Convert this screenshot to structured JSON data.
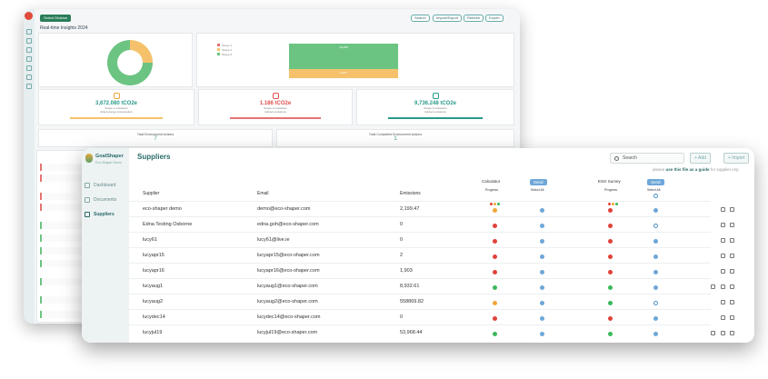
{
  "dashboard": {
    "header_chip": "Select Division",
    "title": "Real-time Insights 2024",
    "top_buttons": [
      "Search",
      "Import/Export",
      "Refresh",
      "Export"
    ],
    "bar_labels": {
      "top": "18,358",
      "bottom": "3,675"
    },
    "legend": [
      "Scope 1",
      "Scope 2",
      "Scope 3"
    ],
    "kpis": [
      {
        "value": "3,672.080 tCO2e",
        "label": "Scope 1 emissions",
        "note": "direct energy consumption",
        "color": "#2a9a8a",
        "bar_color": "#f5c26b"
      },
      {
        "value": "1.186 tCO2e",
        "label": "Scope 2 emissions",
        "note": "indirect emissions",
        "color": "#e05050",
        "bar_color": "#e57373"
      },
      {
        "value": "9,736.248 tCO2e",
        "label": "Scope 3 emissions",
        "note": "indirect emissions",
        "color": "#2a9a8a",
        "bar_color": "#2a9a8a"
      }
    ],
    "totals": [
      {
        "label": "Total Environment Actions",
        "value": "7"
      },
      {
        "label": "Total Completed Environment Actions",
        "value": "1"
      }
    ]
  },
  "sidebar": {
    "brand": "GoalShaper",
    "tagline": "Eco-Shaper Demo",
    "items": [
      {
        "label": "Dashboard",
        "icon": "dashboard-icon"
      },
      {
        "label": "Documents",
        "icon": "documents-icon"
      },
      {
        "label": "Suppliers",
        "icon": "suppliers-icon",
        "active": true
      }
    ]
  },
  "page": {
    "title": "Suppliers",
    "search_placeholder": "Search",
    "add_label": "+ Add",
    "import_label": "+ Import",
    "guide_prefix": "please",
    "guide_link": "use this file as a guide",
    "guide_suffix": "for supplier imp"
  },
  "table": {
    "headers": {
      "supplier": "Supplier",
      "email": "Email",
      "emissions": "Emissions"
    },
    "calculator": {
      "title": "Calculator",
      "send": "Send",
      "progress": "Progress",
      "select_all": "Select All"
    },
    "survey": {
      "title": "ESG Survey",
      "send": "Send",
      "progress": "Progress",
      "select_all": "Select All"
    },
    "rows": [
      {
        "supplier": "eco-shaper demo",
        "email": "demo@eco-shaper.com",
        "emissions": "2,199.47",
        "calc": "orange",
        "survey": "red",
        "survey_sel": "dot"
      },
      {
        "supplier": "Edna Testing Osborne",
        "email": "edna.goh@eco-shaper.com",
        "emissions": "0",
        "calc": "red",
        "survey": "red",
        "survey_sel": "ring"
      },
      {
        "supplier": "lucy61",
        "email": "lucy61@live.ie",
        "emissions": "0",
        "calc": "red",
        "survey": "red",
        "survey_sel": "dot"
      },
      {
        "supplier": "lucyapr15",
        "email": "lucyapr15@eco-shaper.com",
        "emissions": "2",
        "calc": "red",
        "survey": "red",
        "survey_sel": "dot"
      },
      {
        "supplier": "lucyapr16",
        "email": "lucyapr16@eco-shaper.com",
        "emissions": "1,903",
        "calc": "red",
        "survey": "red",
        "survey_sel": "dot"
      },
      {
        "supplier": "lucyaug1",
        "email": "lucyaug1@eco-shaper.com",
        "emissions": "8,932.61",
        "calc": "green",
        "survey": "green",
        "survey_sel": "dot"
      },
      {
        "supplier": "lucyaug2",
        "email": "lucyaug2@eco-shaper.com",
        "emissions": "558869.82",
        "calc": "orange",
        "survey": "green",
        "survey_sel": "ring"
      },
      {
        "supplier": "lucydec14",
        "email": "lucydec14@eco-shaper.com",
        "emissions": "0",
        "calc": "red",
        "survey": "red",
        "survey_sel": "dot"
      },
      {
        "supplier": "lucyjul19",
        "email": "lucyjul19@eco-shaper.com",
        "emissions": "53,968.44",
        "calc": "green",
        "survey": "green",
        "survey_sel": "dot"
      }
    ]
  },
  "colors": {
    "red": "#e0423a",
    "orange": "#f0a63a",
    "green": "#3bb85a",
    "blue": "#6ea7d8",
    "accent": "#2a6c6a"
  }
}
